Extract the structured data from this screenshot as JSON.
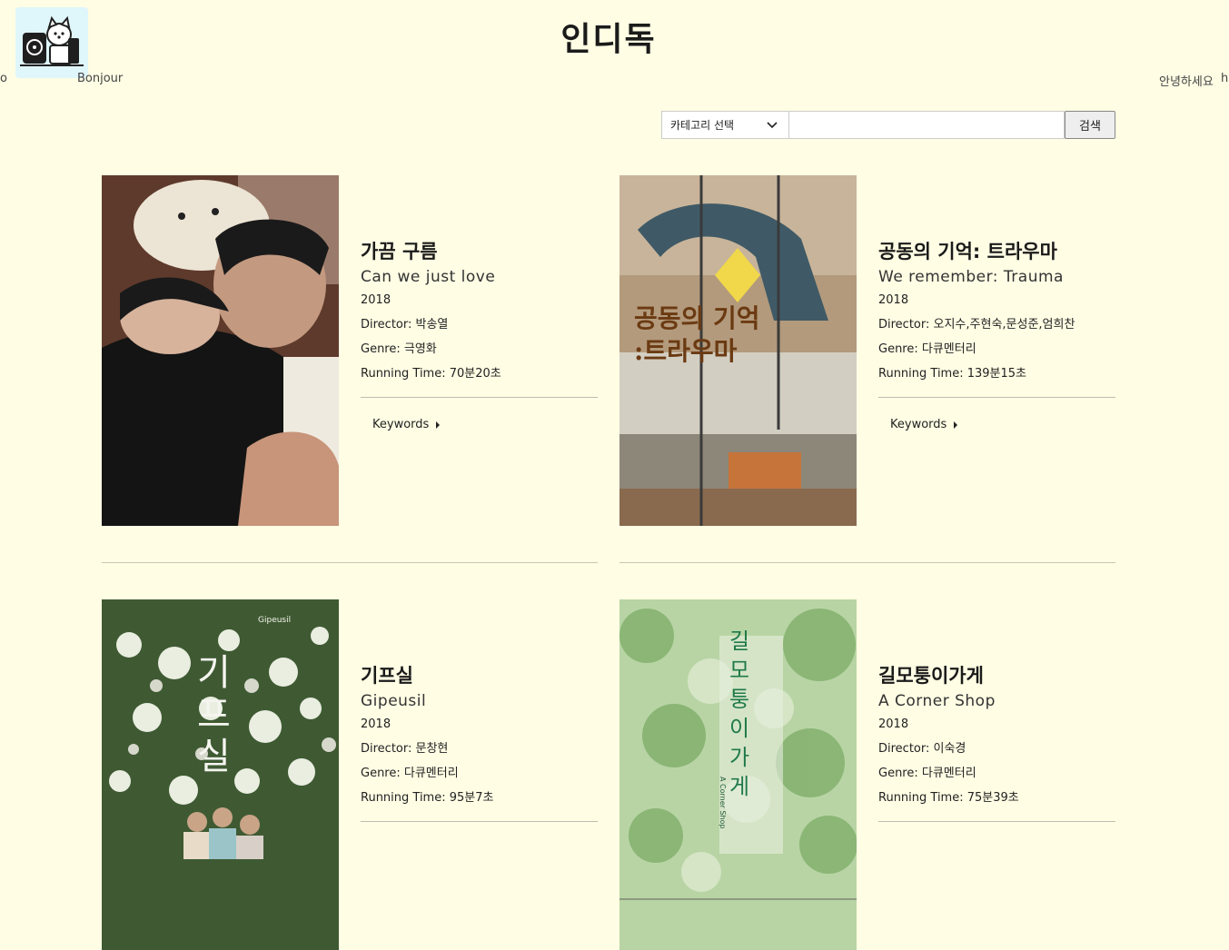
{
  "header": {
    "site_title": "인디독",
    "marquee": [
      "o",
      "Bonjour",
      "안녕하세요",
      "h"
    ]
  },
  "search": {
    "category_label": "카테고리 선택",
    "input_value": "",
    "button_label": "검색"
  },
  "movies": [
    {
      "title_ko": "가끔 구름",
      "title_en": "Can we just love",
      "year": "2018",
      "director": "Director: 박송열",
      "genre": "Genre: 극영화",
      "running_time": "Running Time: 70분20초",
      "keywords_label": "Keywords"
    },
    {
      "title_ko": "공동의 기억: 트라우마",
      "title_en": "We remember: Trauma",
      "year": "2018",
      "director": "Director: 오지수,주현숙,문성준,엄희찬",
      "genre": "Genre: 다큐멘터리",
      "running_time": "Running Time: 139분15초",
      "keywords_label": "Keywords",
      "poster_text": "공동의 기억 :트라우마"
    },
    {
      "title_ko": "기프실",
      "title_en": "Gipeusil",
      "year": "2018",
      "director": "Director: 문창현",
      "genre": "Genre: 다큐멘터리",
      "running_time": "Running Time: 95분7초",
      "poster_text": "기프실",
      "poster_caption": "Gipeusil"
    },
    {
      "title_ko": "길모퉁이가게",
      "title_en": "A Corner Shop",
      "year": "2018",
      "director": "Director: 이숙경",
      "genre": "Genre: 다큐멘터리",
      "running_time": "Running Time: 75분39초",
      "poster_text": "길모퉁이가게",
      "poster_caption": "A Corner Shop"
    }
  ]
}
